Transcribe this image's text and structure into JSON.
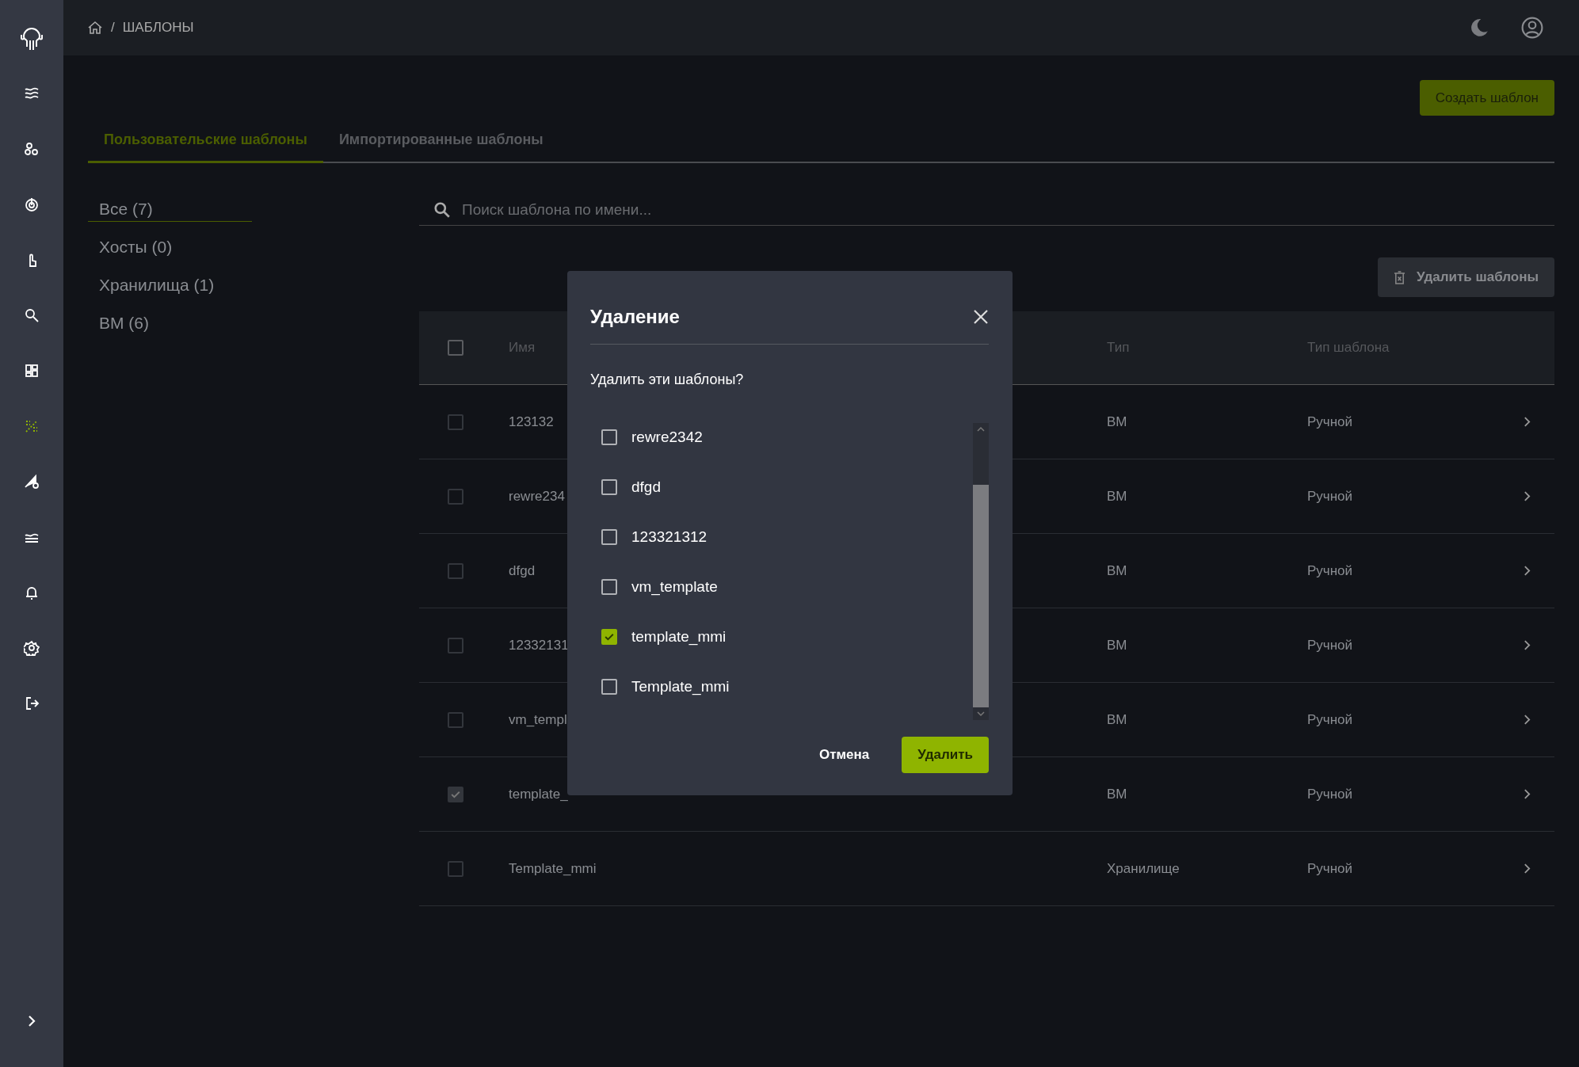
{
  "sidebar": {
    "nav": [
      {
        "selected": false
      },
      {
        "selected": false
      },
      {
        "selected": false
      },
      {
        "selected": false
      },
      {
        "selected": false
      },
      {
        "selected": false
      },
      {
        "selected": true
      },
      {
        "selected": false
      },
      {
        "selected": false
      },
      {
        "selected": false
      },
      {
        "selected": false
      },
      {
        "selected": false
      }
    ]
  },
  "breadcrumb": {
    "separator": "/",
    "current": "ШАБЛОНЫ"
  },
  "create_button": "Создать шаблон",
  "tabs": [
    {
      "label": "Пользовательские шаблоны",
      "selected": true
    },
    {
      "label": "Импортированные шаблоны",
      "selected": false
    }
  ],
  "filters": [
    {
      "label": "Все (7)",
      "selected": true
    },
    {
      "label": "Хосты (0)",
      "selected": false
    },
    {
      "label": "Хранилища (1)",
      "selected": false
    },
    {
      "label": "ВМ (6)",
      "selected": false
    }
  ],
  "search": {
    "placeholder": "Поиск шаблона по имени..."
  },
  "delete_templates_button": "Удалить шаблоны",
  "table": {
    "select_all_checked": false,
    "columns": [
      "Имя",
      "Тип",
      "Тип шаблона"
    ],
    "rows": [
      {
        "name": "123132",
        "type": "ВМ",
        "template_type": "Ручной",
        "checked": false
      },
      {
        "name": "rewre234",
        "type": "ВМ",
        "template_type": "Ручной",
        "checked": false
      },
      {
        "name": "dfgd",
        "type": "ВМ",
        "template_type": "Ручной",
        "checked": false
      },
      {
        "name": "12332131",
        "type": "ВМ",
        "template_type": "Ручной",
        "checked": false
      },
      {
        "name": "vm_templ",
        "type": "ВМ",
        "template_type": "Ручной",
        "checked": false
      },
      {
        "name": "template_",
        "type": "ВМ",
        "template_type": "Ручной",
        "checked": true
      },
      {
        "name": "Template_mmi",
        "type": "Хранилище",
        "template_type": "Ручной",
        "checked": false
      }
    ]
  },
  "dialog": {
    "title": "Удаление",
    "question": "Удалить эти шаблоны?",
    "items": [
      {
        "label": "rewre2342",
        "checked": false
      },
      {
        "label": "dfgd",
        "checked": false
      },
      {
        "label": "123321312",
        "checked": false
      },
      {
        "label": "vm_template",
        "checked": false
      },
      {
        "label": "template_mmi",
        "checked": true
      },
      {
        "label": "Template_mmi",
        "checked": false
      }
    ],
    "cancel": "Отмена",
    "confirm": "Удалить"
  }
}
